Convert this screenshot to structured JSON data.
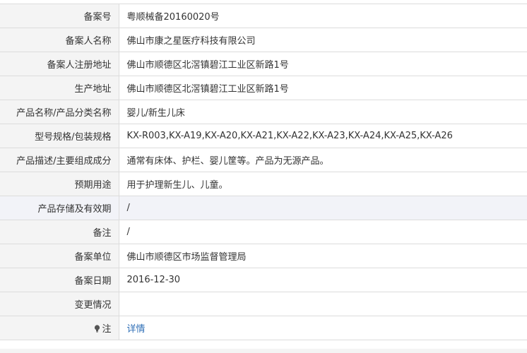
{
  "record": {
    "rows": [
      {
        "label": "备案号",
        "value": "粤顺械备20160020号"
      },
      {
        "label": "备案人名称",
        "value": "佛山市康之星医疗科技有限公司"
      },
      {
        "label": "备案人注册地址",
        "value": "佛山市顺德区北滘镇碧江工业区新路1号"
      },
      {
        "label": "生产地址",
        "value": "佛山市顺德区北滘镇碧江工业区新路1号"
      },
      {
        "label": "产品名称/产品分类名称",
        "value": "婴儿/新生儿床"
      },
      {
        "label": "型号规格/包装规格",
        "value": "KX-R003,KX-A19,KX-A20,KX-A21,KX-A22,KX-A23,KX-A24,KX-A25,KX-A26"
      },
      {
        "label": "产品描述/主要组成成分",
        "value": "通常有床体、护栏、婴儿筐等。产品为无源产品。"
      },
      {
        "label": "预期用途",
        "value": "用于护理新生儿、儿童。"
      },
      {
        "label": "产品存储及有效期",
        "value": "/"
      },
      {
        "label": "备注",
        "value": "/"
      },
      {
        "label": "备案单位",
        "value": "佛山市顺德区市场监督管理局"
      },
      {
        "label": "备案日期",
        "value": "2016-12-30"
      },
      {
        "label": "变更情况",
        "value": ""
      }
    ],
    "note": {
      "label": "注",
      "link_text": "详情",
      "icon": "lightbulb-icon"
    }
  },
  "colors": {
    "label_bg": "#f4f4f4",
    "highlight_bg": "#f2f3f8",
    "link": "#2f6fb7",
    "border": "#dcdcdc"
  }
}
